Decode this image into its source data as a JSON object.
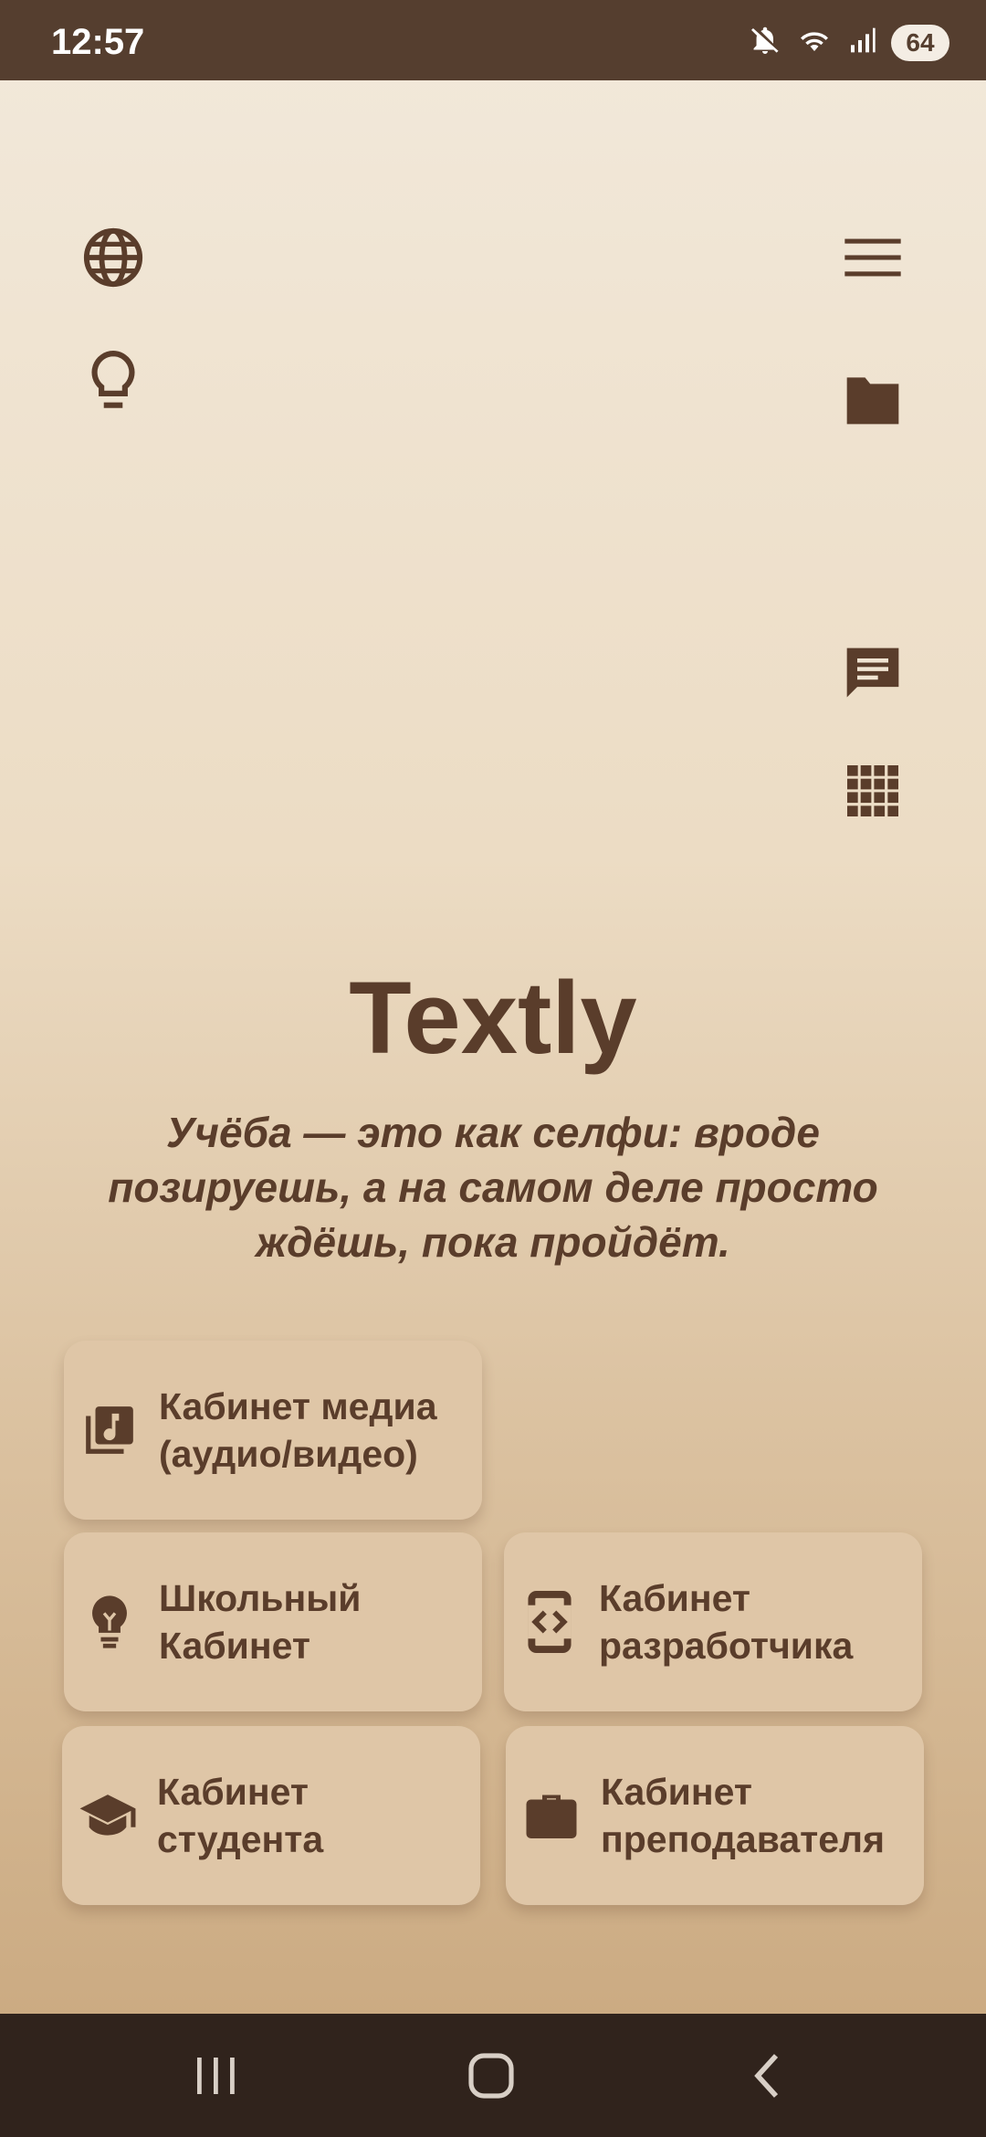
{
  "status_bar": {
    "time": "12:57",
    "battery": "64",
    "icons": [
      "mute-icon",
      "wifi-icon",
      "signal-icon",
      "battery-icon"
    ]
  },
  "toolbar": {
    "left": [
      "globe-icon",
      "lightbulb-icon"
    ],
    "right": [
      "menu-icon",
      "folder-icon",
      "chat-icon",
      "apps-grid-icon"
    ]
  },
  "app": {
    "title": "Textly",
    "quote": "Учёба — это как селфи: вроде позируешь, а на самом деле просто ждёшь, пока пройдёт."
  },
  "cards": [
    {
      "label_line1": "Кабинет медиа",
      "label_line2": "(аудио/видео)",
      "icon": "media-library-icon"
    },
    {
      "label_line1": "Школьный",
      "label_line2": "Кабинет",
      "icon": "lightbulb-icon"
    },
    {
      "label_line1": "Кабинет",
      "label_line2": "разработчика",
      "icon": "developer-mode-icon"
    },
    {
      "label_line1": "Кабинет",
      "label_line2": "студента",
      "icon": "graduation-cap-icon"
    },
    {
      "label_line1": "Кабинет",
      "label_line2": "преподавателя",
      "icon": "briefcase-icon"
    }
  ],
  "nav_bar": {
    "buttons": [
      "recents-icon",
      "home-icon",
      "back-icon"
    ]
  },
  "colors": {
    "accent": "#5a3d2b",
    "status_bar": "#553e2f",
    "nav_bar": "#30231c",
    "card": "#dfc6a7"
  }
}
